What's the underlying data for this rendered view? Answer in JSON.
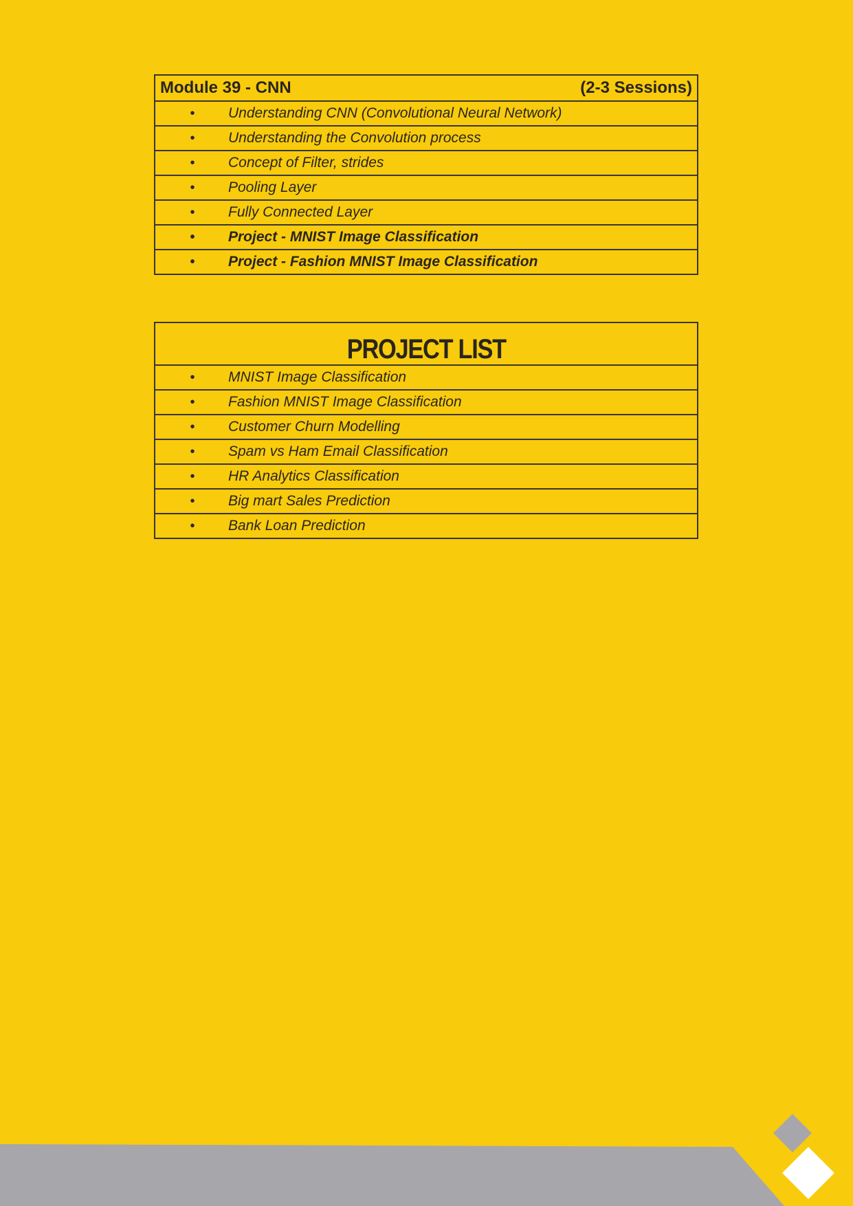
{
  "module": {
    "title": "Module 39 - CNN",
    "sessions": "(2-3 Sessions)",
    "bullet": "•",
    "items": [
      "Understanding CNN (Convolutional Neural Network)",
      "Understanding the Convolution process",
      "Concept of Filter, strides",
      "Pooling Layer",
      "Fully Connected Layer",
      "Project - MNIST Image Classification",
      "Project - Fashion MNIST Image Classification"
    ]
  },
  "projects": {
    "title": "PROJECT LIST",
    "items": [
      "MNIST Image Classification",
      "Fashion MNIST Image Classification",
      "Customer Churn Modelling",
      "Spam vs Ham Email Classification",
      "HR Analytics Classification",
      "Big mart Sales Prediction",
      "Bank Loan Prediction"
    ]
  },
  "colors": {
    "background": "#F8CB0C",
    "footer_band": "#A7A6AB",
    "diamond_gray": "#A7A6AB",
    "diamond_white": "#FFFFFF",
    "text": "#2a2520"
  }
}
